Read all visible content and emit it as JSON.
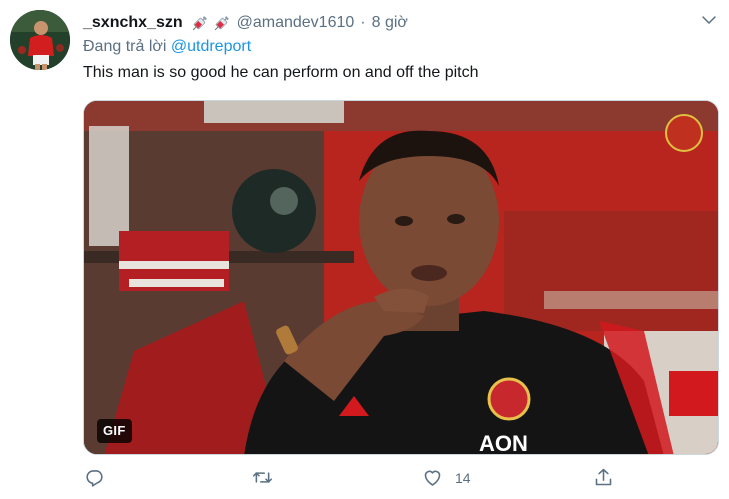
{
  "tweet": {
    "display_name": "_sxnchx_szn",
    "handle": "@amandev1610",
    "separator": "·",
    "time": "8 giờ",
    "reply_prefix": "Đang trả lời ",
    "reply_mention": "@utdreport",
    "text": "This man is so good he can perform on and off the pitch",
    "badges": [
      "syringe-emoji",
      "syringe-emoji"
    ]
  },
  "media": {
    "type_badge": "GIF",
    "description_colors": {
      "wall": "#c2261f",
      "shirt": "#141414",
      "accent": "#d2191d"
    }
  },
  "actions": {
    "reply": {
      "icon": "reply-icon",
      "count": ""
    },
    "retweet": {
      "icon": "retweet-icon",
      "count": ""
    },
    "like": {
      "icon": "heart-icon",
      "count": "14"
    },
    "share": {
      "icon": "share-icon",
      "count": ""
    }
  },
  "colors": {
    "link": "#1b95e0",
    "muted": "#5b7083",
    "text": "#14171a"
  }
}
